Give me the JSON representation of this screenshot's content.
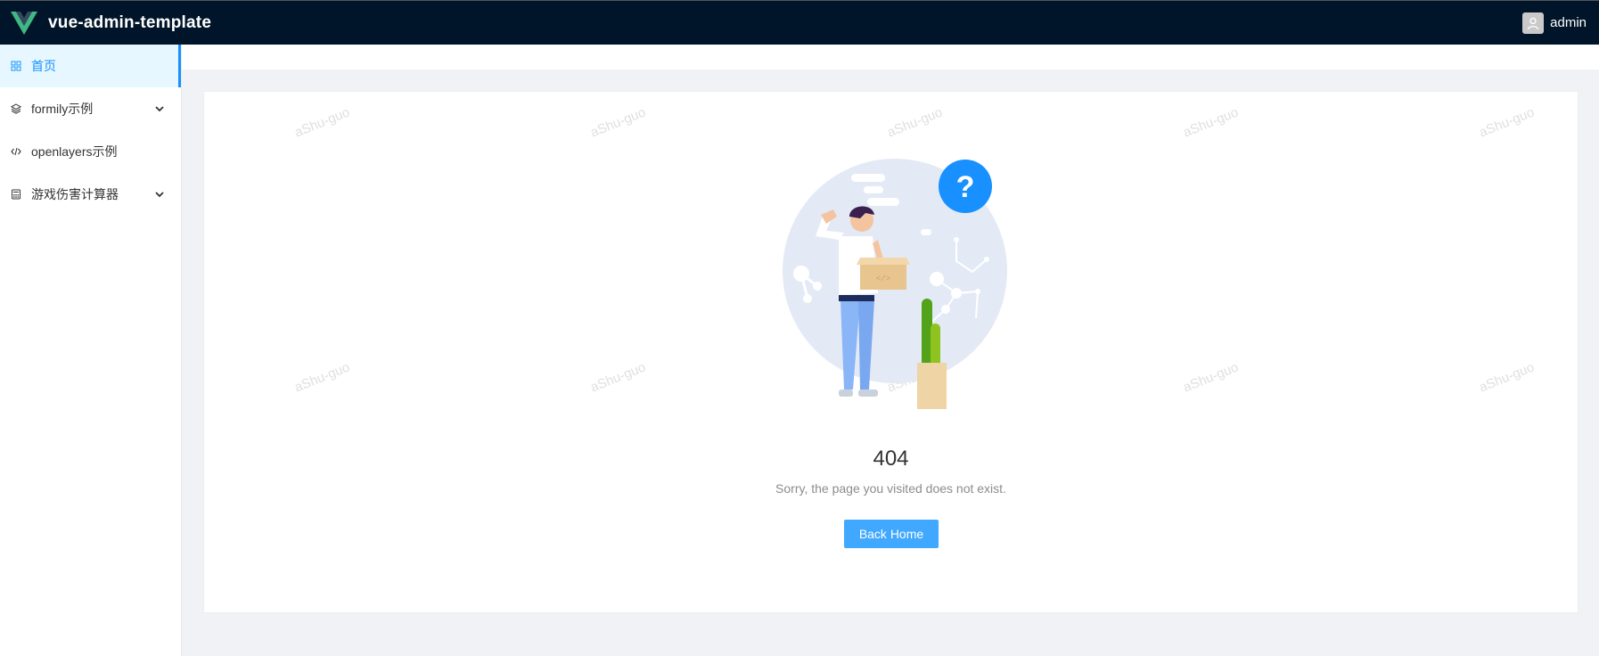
{
  "header": {
    "title": "vue-admin-template",
    "user": {
      "name": "admin",
      "avatar_icon": "user-avatar-icon"
    }
  },
  "sidebar": {
    "items": [
      {
        "label": "首页",
        "icon": "dashboard-icon",
        "active": true
      },
      {
        "label": "formily示例",
        "icon": "layers-icon",
        "expandable": true
      },
      {
        "label": "openlayers示例",
        "icon": "code-icon"
      },
      {
        "label": "游戏伤害计算器",
        "icon": "calculator-icon",
        "expandable": true
      }
    ]
  },
  "error": {
    "code": "404",
    "message": "Sorry, the page you visited does not exist.",
    "button_label": "Back Home"
  },
  "watermark": {
    "text": "aShu-guo"
  },
  "colors": {
    "topbar": "#001529",
    "accent": "#1890ff",
    "button": "#40a9ff",
    "active_bg": "#e6f7ff",
    "page_bg": "#f0f2f5"
  }
}
